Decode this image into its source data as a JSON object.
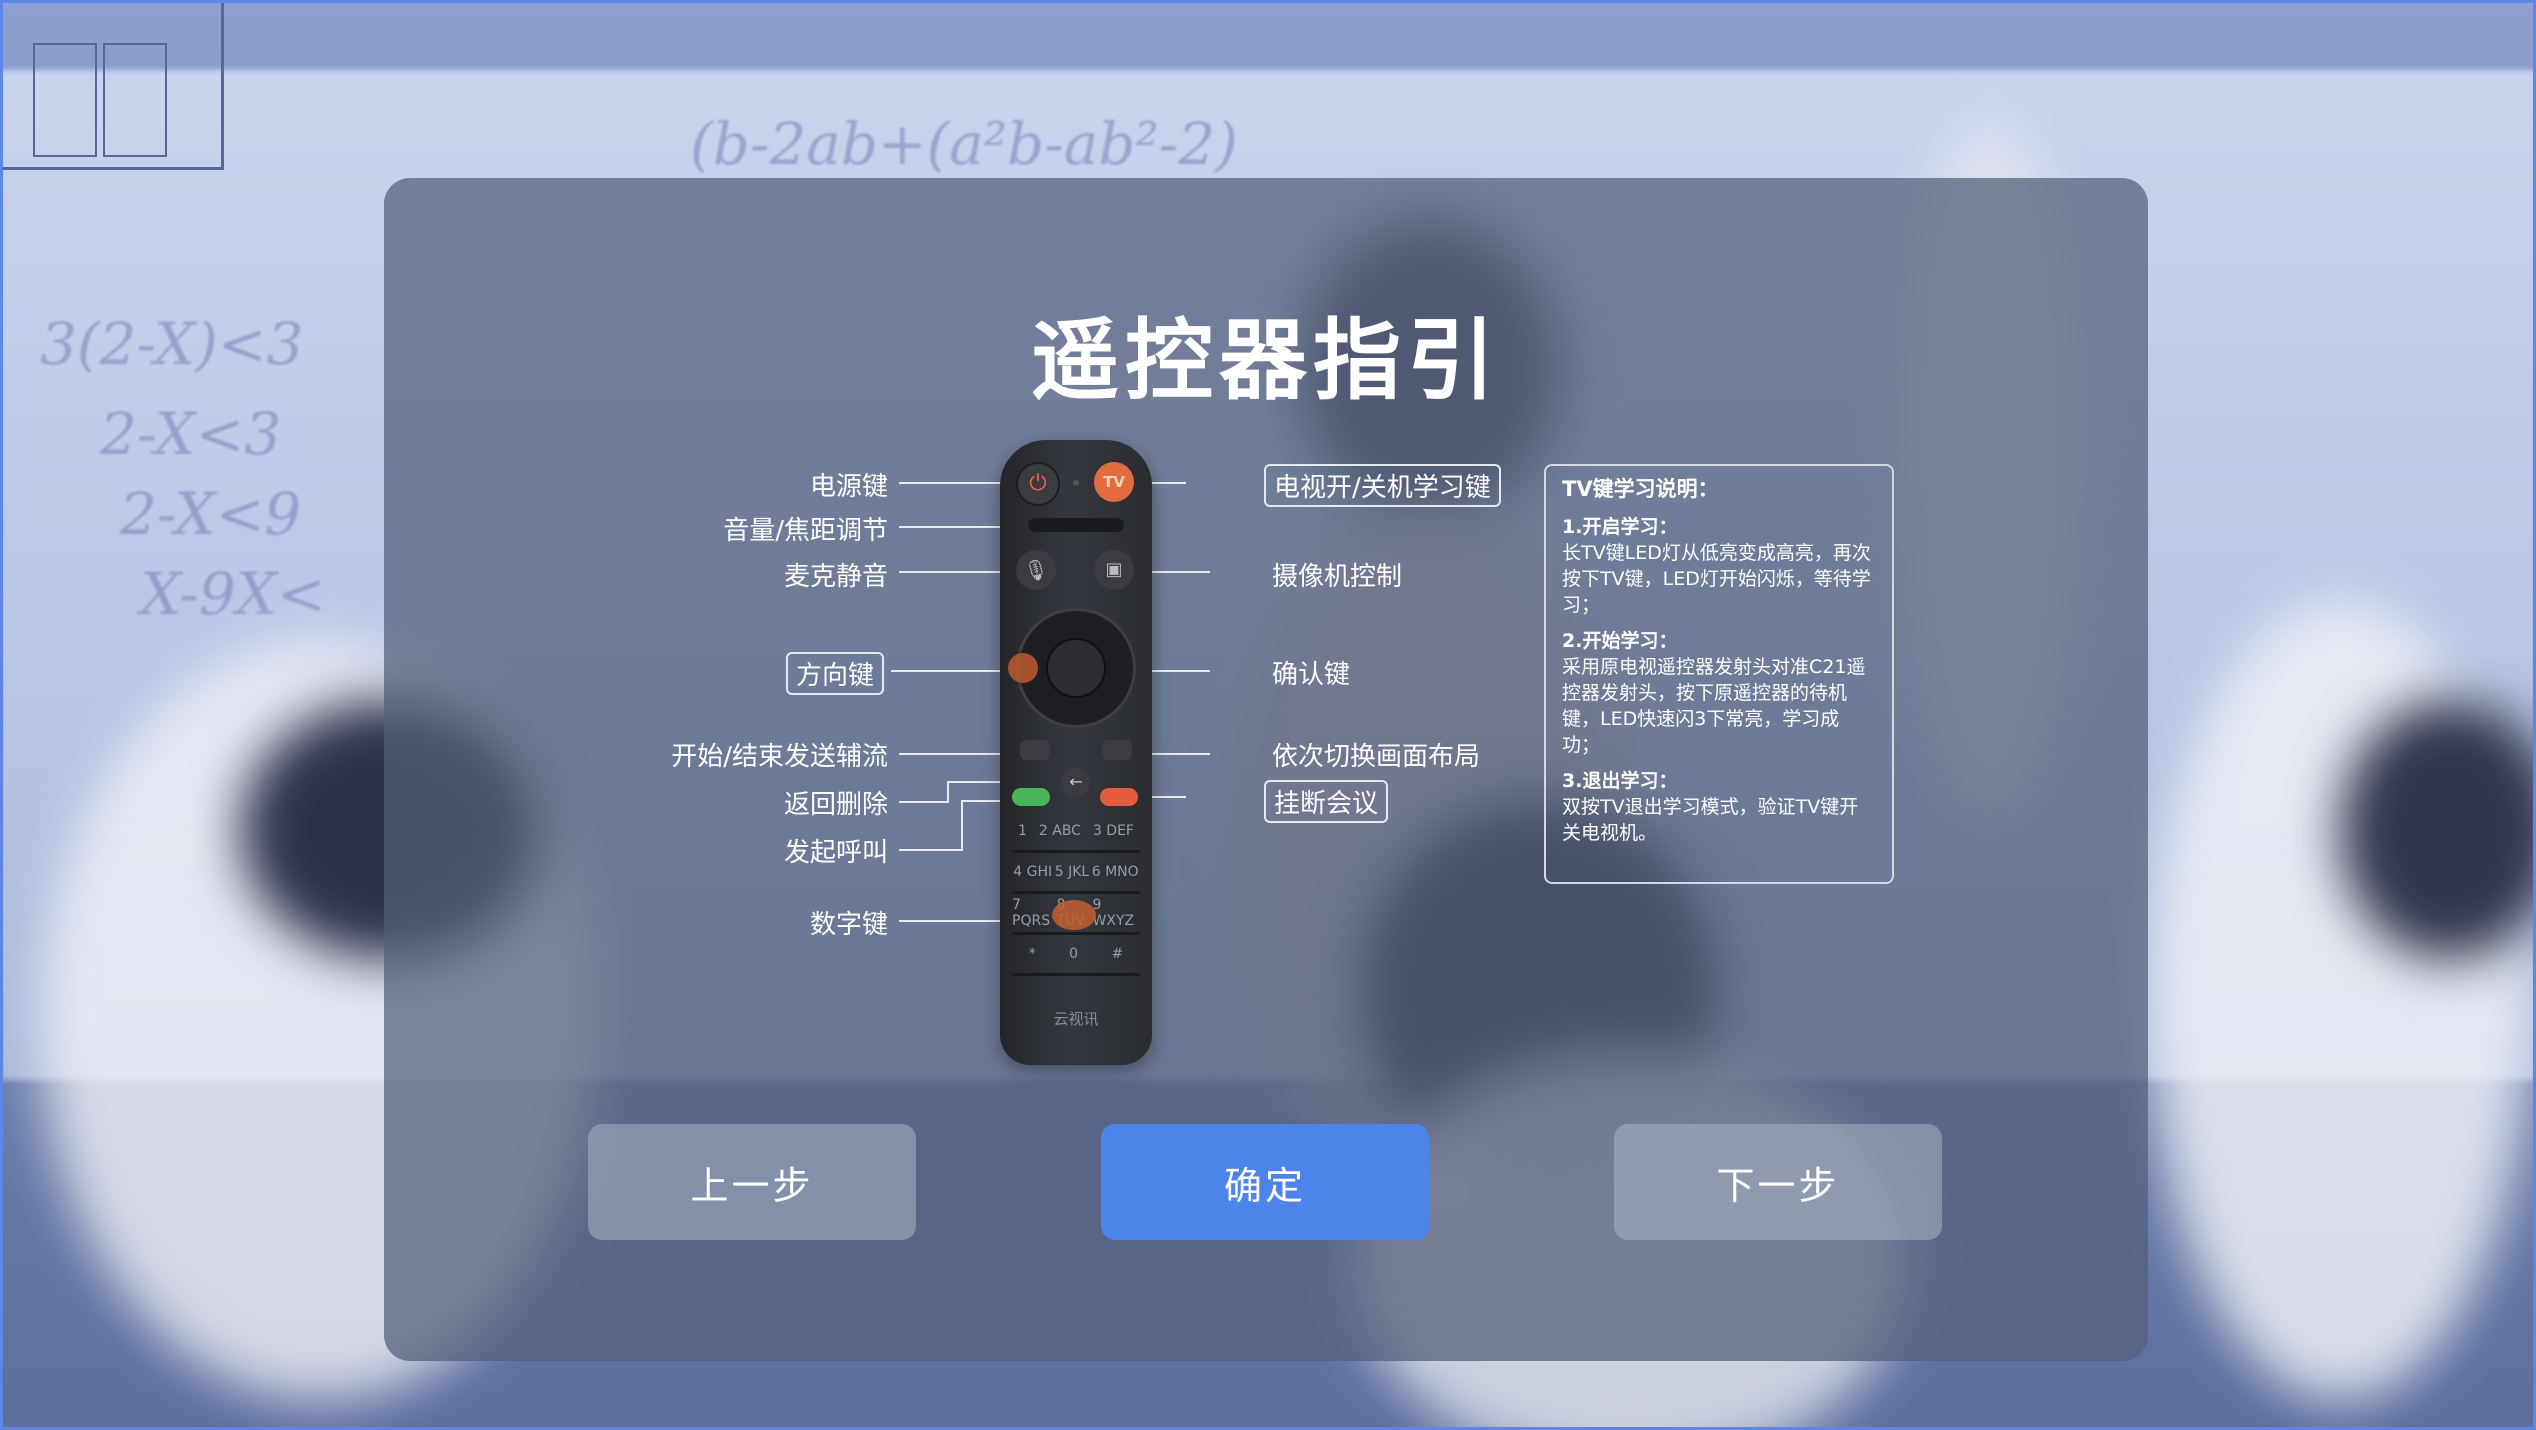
{
  "title": "遥控器指引",
  "left_labels": {
    "power": "电源键",
    "volume": "音量/焦距调节",
    "mic_mute": "麦克静音",
    "direction": "方向键",
    "share": "开始/结束发送辅流",
    "back": "返回删除",
    "call": "发起呼叫",
    "numbers": "数字键"
  },
  "right_labels": {
    "tv_learn": "电视开/关机学习键",
    "camera": "摄像机控制",
    "confirm": "确认键",
    "layout": "依次切换画面布局",
    "hangup": "挂断会议"
  },
  "remote": {
    "tv_key": "TV",
    "brand": "云视讯",
    "keys": [
      [
        "1",
        "2 ABC",
        "3 DEF"
      ],
      [
        "4 GHI",
        "5 JKL",
        "6 MNO"
      ],
      [
        "7 PQRS",
        "8 TUV",
        "9 WXYZ"
      ],
      [
        "*",
        "0",
        "#"
      ]
    ]
  },
  "info": {
    "heading": "TV键学习说明：",
    "step1_title": "1.开启学习：",
    "step1_text": "长TV键LED灯从低亮变成高亮，再次按下TV键，LED灯开始闪烁，等待学习；",
    "step2_title": "2.开始学习：",
    "step2_text": "采用原电视遥控器发射头对准C21遥控器发射头，按下原遥控器的待机键，LED快速闪3下常亮，学习成功；",
    "step3_title": "3.退出学习：",
    "step3_text": "双按TV退出学习模式，验证TV键开关电视机。"
  },
  "buttons": {
    "prev": "上一步",
    "confirm": "确定",
    "next": "下一步"
  },
  "colors": {
    "confirm_button": "#4d84ea",
    "dialog_bg": "rgba(82,94,122,0.72)",
    "accent_border": "#5e86e2"
  }
}
